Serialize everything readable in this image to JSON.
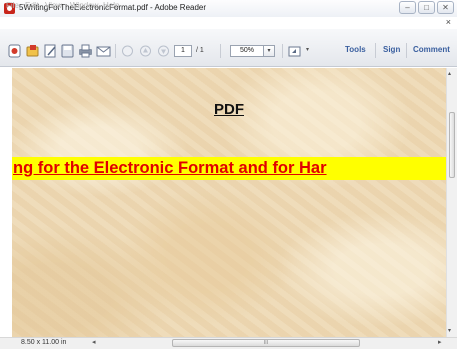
{
  "window": {
    "title": "5WritingForTheElectronicFormat.pdf - Adobe Reader",
    "minimize": "–",
    "maximize": "□",
    "close": "✕"
  },
  "menu": {
    "items": [
      "File",
      "Edit",
      "View",
      "Window",
      "Help"
    ],
    "close_doc": "×"
  },
  "toolbar": {
    "page_current": "1",
    "page_total": "/ 1",
    "zoom": "50%",
    "zoom_arrow": "▾",
    "tools": "Tools",
    "sign": "Sign",
    "comment": "Comment",
    "icons": [
      "create-pdf-icon",
      "open-icon",
      "edit-icon",
      "save-icon",
      "print-icon",
      "email-icon",
      "select-icon",
      "prev-page-icon",
      "next-page-icon",
      "read-mode-icon"
    ]
  },
  "document": {
    "heading": "PDF",
    "banner": "ng for the Electronic Format and for Har",
    "banner_color": "#e10000",
    "banner_background": "#ffff00"
  },
  "status": {
    "page_size": "8.50 x 11.00 in",
    "scroll_left": "◂",
    "scroll_right": "▸",
    "scroll_grip": "III",
    "scroll_up": "▴",
    "scroll_down": "▾"
  }
}
